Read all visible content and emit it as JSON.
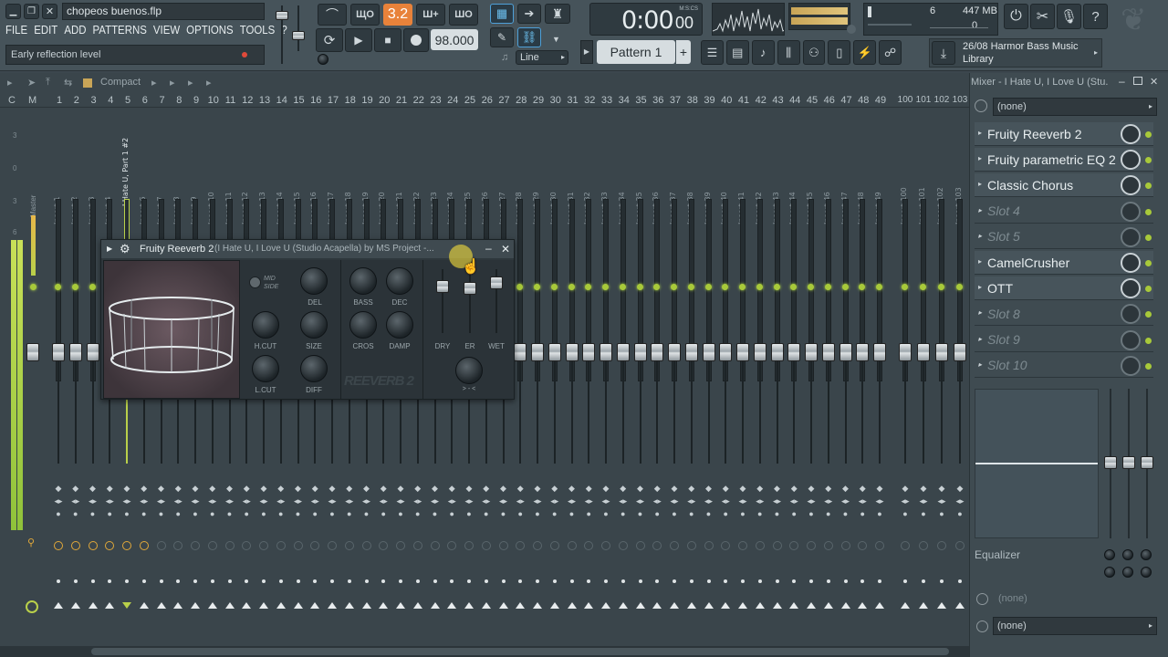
{
  "title_bar": {
    "file_name": "chopeos buenos.flp"
  },
  "menu": [
    "FILE",
    "EDIT",
    "ADD",
    "PATTERNS",
    "VIEW",
    "OPTIONS",
    "TOOLS",
    "?"
  ],
  "hint_bar": {
    "text": "Early reflection level"
  },
  "transport": {
    "pattern_song_mode": "3.2",
    "tempo": "98.000",
    "snap_mode": "Line",
    "time_display": {
      "main": "0:00",
      "sub": "00",
      "units": "M:S:CS"
    },
    "cpu": "6",
    "memory": "447 MB",
    "polyphony": "0"
  },
  "pattern_selector": {
    "label": "Pattern 1"
  },
  "news": {
    "line1": "26/08  Harmor Bass Music",
    "line2": "Library"
  },
  "mixer_toolbar": {
    "compact_label": "Compact"
  },
  "mixer_header": {
    "C": "C",
    "M": "M",
    "numbers": [
      "1",
      "2",
      "3",
      "4",
      "5",
      "6",
      "7",
      "8",
      "9",
      "10",
      "11",
      "12",
      "13",
      "14",
      "15",
      "16",
      "17",
      "18",
      "19",
      "20",
      "21",
      "22",
      "23",
      "24",
      "25",
      "26",
      "27",
      "28",
      "29",
      "30",
      "31",
      "32",
      "33",
      "34",
      "35",
      "36",
      "37",
      "38",
      "39",
      "40",
      "41",
      "42",
      "43",
      "44",
      "45",
      "46",
      "47",
      "48",
      "49"
    ],
    "numbers_right": [
      "100",
      "101",
      "102",
      "103"
    ]
  },
  "tracks": {
    "master": "Master",
    "insert_5": "I Hate U, Part 1 #2",
    "insert_prefix": "Insert",
    "right": [
      "Insert 100",
      "Insert 101",
      "Insert 102",
      "Insert 103"
    ]
  },
  "scale_labels": [
    "3",
    "0",
    "3",
    "6"
  ],
  "plugin_window": {
    "title": "Fruity Reeverb 2",
    "subtitle": "(I Hate U, I Love U (Studio Acapella) by MS Project -...",
    "mid_side_label": "MID SIDE",
    "knob_labels": {
      "del": "DEL",
      "bass": "BASS",
      "dec": "DEC",
      "hcut": "H.CUT",
      "size": "SIZE",
      "cros": "CROS",
      "damp": "DAMP",
      "lcut": "L.CUT",
      "diff": "DIFF"
    },
    "fader_labels": {
      "dry": "DRY",
      "er": "ER",
      "wet": "WET"
    },
    "stereo_label": "> - <",
    "logo": "REEVERB 2"
  },
  "mixer_panel": {
    "title": "Mixer - I Hate U, I Love U (Stu...",
    "input": "(none)",
    "slots": [
      {
        "name": "Fruity Reeverb 2",
        "empty": false
      },
      {
        "name": "Fruity parametric EQ 2",
        "empty": false
      },
      {
        "name": "Classic Chorus",
        "empty": false
      },
      {
        "name": "Slot 4",
        "empty": true
      },
      {
        "name": "Slot 5",
        "empty": true
      },
      {
        "name": "CamelCrusher",
        "empty": false
      },
      {
        "name": "OTT",
        "empty": false
      },
      {
        "name": "Slot 8",
        "empty": true
      },
      {
        "name": "Slot 9",
        "empty": true
      },
      {
        "name": "Slot 10",
        "empty": true
      }
    ],
    "equalizer_label": "Equalizer",
    "route_none": "(none)",
    "output": "(none)"
  },
  "colors": {
    "accent_green": "#a8c93a",
    "orange": "#e8823a",
    "panel": "#3c474e",
    "selected": "#4ea0d8"
  },
  "icons": [
    "menu-arrow-icon",
    "settings-gear-icon",
    "minimize-icon",
    "close-icon",
    "play-icon",
    "stop-icon",
    "record-icon",
    "loop-icon",
    "metronome-icon",
    "link-icon",
    "piano-roll-icon",
    "channel-rack-icon",
    "mixer-icon",
    "browser-icon",
    "plugin-icon",
    "download-icon",
    "cpu-icon",
    "help-icon"
  ]
}
